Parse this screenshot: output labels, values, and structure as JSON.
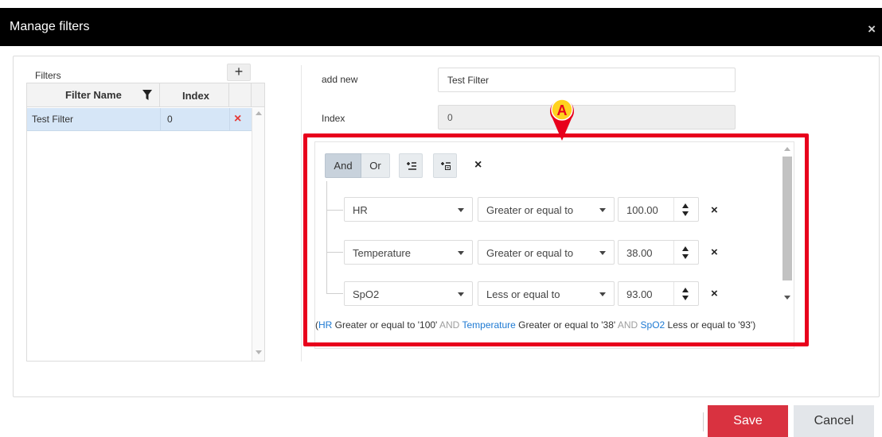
{
  "dialog": {
    "title": "Manage filters",
    "close_icon": "×"
  },
  "filters_panel": {
    "label": "Filters",
    "add_icon": "+",
    "columns": [
      "Filter Name",
      "Index"
    ],
    "rows": [
      {
        "name": "Test Filter",
        "index": "0",
        "delete_icon": "×"
      }
    ]
  },
  "form": {
    "name_label": "add new",
    "name_value": "Test Filter",
    "index_label": "Index",
    "index_value": "0"
  },
  "marker": {
    "label": "A",
    "color": "#e8001c"
  },
  "builder": {
    "and_label": "And",
    "or_label": "Or",
    "remove_group_icon": "×",
    "conditions": [
      {
        "field": "HR",
        "operator": "Greater or equal to",
        "value": "100.00",
        "remove_icon": "×"
      },
      {
        "field": "Temperature",
        "operator": "Greater or equal to",
        "value": "38.00",
        "remove_icon": "×"
      },
      {
        "field": "SpO2",
        "operator": "Less or equal to",
        "value": "93.00",
        "remove_icon": "×"
      }
    ],
    "expression": {
      "open": "(",
      "f1": "HR",
      "t1": " Greater or equal to '100' ",
      "and1": "AND",
      "f2": " Temperature",
      "t2": " Greater or equal to '38' ",
      "and2": "AND",
      "f3": " SpO2",
      "t3": " Less or equal to '93')"
    }
  },
  "footer": {
    "save_label": "Save",
    "cancel_label": "Cancel"
  },
  "colors": {
    "titlebar": "#000000",
    "selected_row": "#d6e6f7",
    "highlight": "#e8001c",
    "save": "#d93240",
    "cancel": "#e3e6ea",
    "field_link": "#1e7ad3"
  }
}
